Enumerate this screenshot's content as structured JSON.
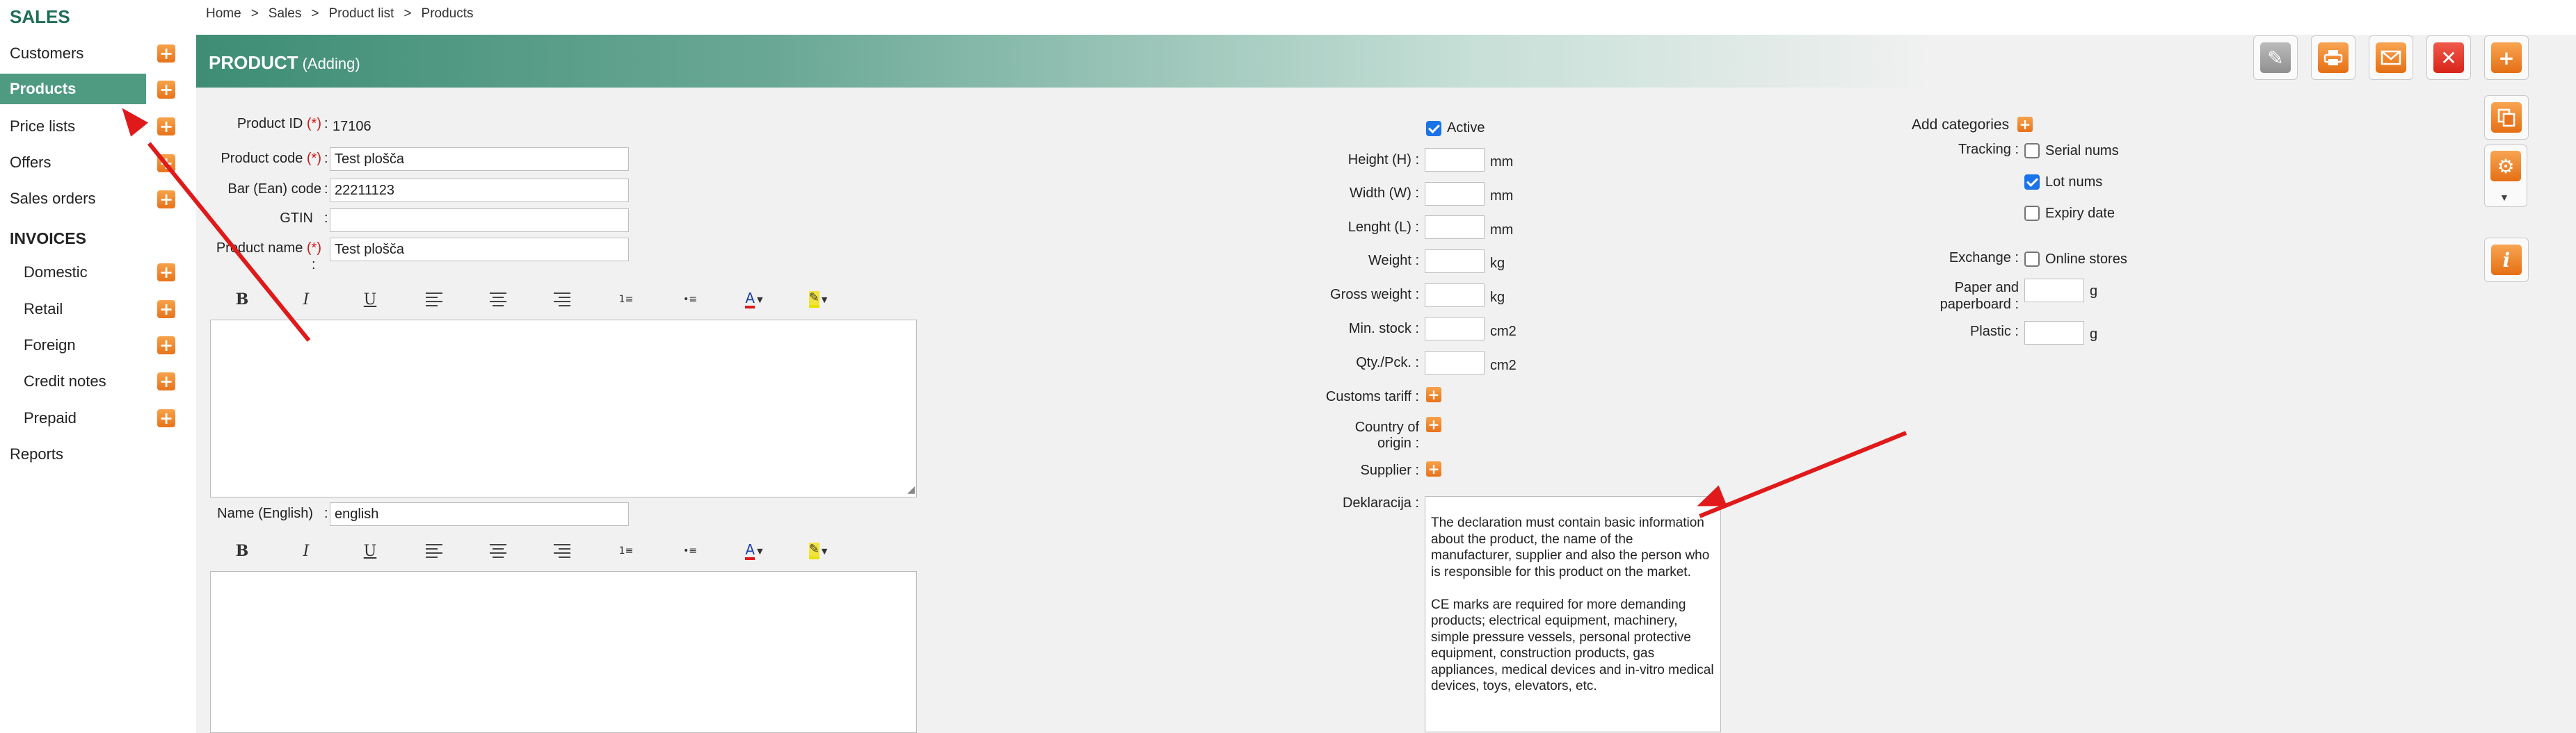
{
  "breadcrumb": [
    "Home",
    "Sales",
    "Product list",
    "Products"
  ],
  "sidebar": {
    "sales_heading": "SALES",
    "sales_items": [
      {
        "label": "Customers"
      },
      {
        "label": "Products",
        "active": true
      },
      {
        "label": "Price lists"
      },
      {
        "label": "Offers"
      },
      {
        "label": "Sales orders"
      }
    ],
    "invoices_heading": "INVOICES",
    "invoice_items": [
      {
        "label": "Domestic"
      },
      {
        "label": "Retail"
      },
      {
        "label": "Foreign"
      },
      {
        "label": "Credit notes"
      },
      {
        "label": "Prepaid"
      }
    ],
    "reports_label": "Reports"
  },
  "header": {
    "title": "PRODUCT",
    "subtitle": "(Adding)"
  },
  "form": {
    "product_id_label": "Product ID",
    "product_id": "17106",
    "product_code_label": "Product code",
    "product_code": "Test plošča",
    "ean_label": "Bar (Ean) code",
    "ean": "22211123",
    "gtin_label": "GTIN",
    "gtin": "",
    "product_name_label": "Product name",
    "product_name": "Test plošča",
    "name_english_label": "Name (English)",
    "name_english": "english",
    "required_mark": "(*)",
    "colon": ":"
  },
  "dimensions": {
    "active_label": "Active",
    "rows": [
      {
        "label": "Height (H) :",
        "unit": "mm"
      },
      {
        "label": "Width (W) :",
        "unit": "mm"
      },
      {
        "label": "Lenght (L) :",
        "unit": "mm"
      },
      {
        "label": "Weight :",
        "unit": "kg"
      },
      {
        "label": "Gross weight :",
        "unit": "kg"
      },
      {
        "label": "Min. stock :",
        "unit": "cm2"
      },
      {
        "label": "Qty./Pck. :",
        "unit": "cm2"
      }
    ],
    "customs_tariff_label": "Customs tariff :",
    "country_origin_label_1": "Country of",
    "country_origin_label_2": "origin :",
    "supplier_label": "Supplier :",
    "declaration_label": "Deklaracija :",
    "declaration_text": "The declaration must contain basic information about the product, the name of the manufacturer, supplier and also the person who is responsible for this product on the market.\n\nCE marks are required for more demanding products; electrical equipment, machinery, simple pressure vessels, personal protective equipment, construction products, gas appliances, medical devices and in-vitro medical devices, toys, elevators, etc."
  },
  "categories": {
    "add_label": "Add categories",
    "tracking_label": "Tracking :",
    "serial_nums": "Serial nums",
    "lot_nums": "Lot nums",
    "expiry_date": "Expiry date",
    "exchange_label": "Exchange :",
    "online_stores": "Online stores",
    "paper_label_1": "Paper and",
    "paper_label_2": "paperboard :",
    "paper_unit": "g",
    "plastic_label": "Plastic :",
    "plastic_unit": "g"
  },
  "editor_toolbar": [
    "B",
    "I",
    "U"
  ],
  "colors": {
    "accent": "#4f9b82",
    "orange": "#e8731b",
    "red": "#d8241a",
    "arrow": "#e0191b"
  }
}
